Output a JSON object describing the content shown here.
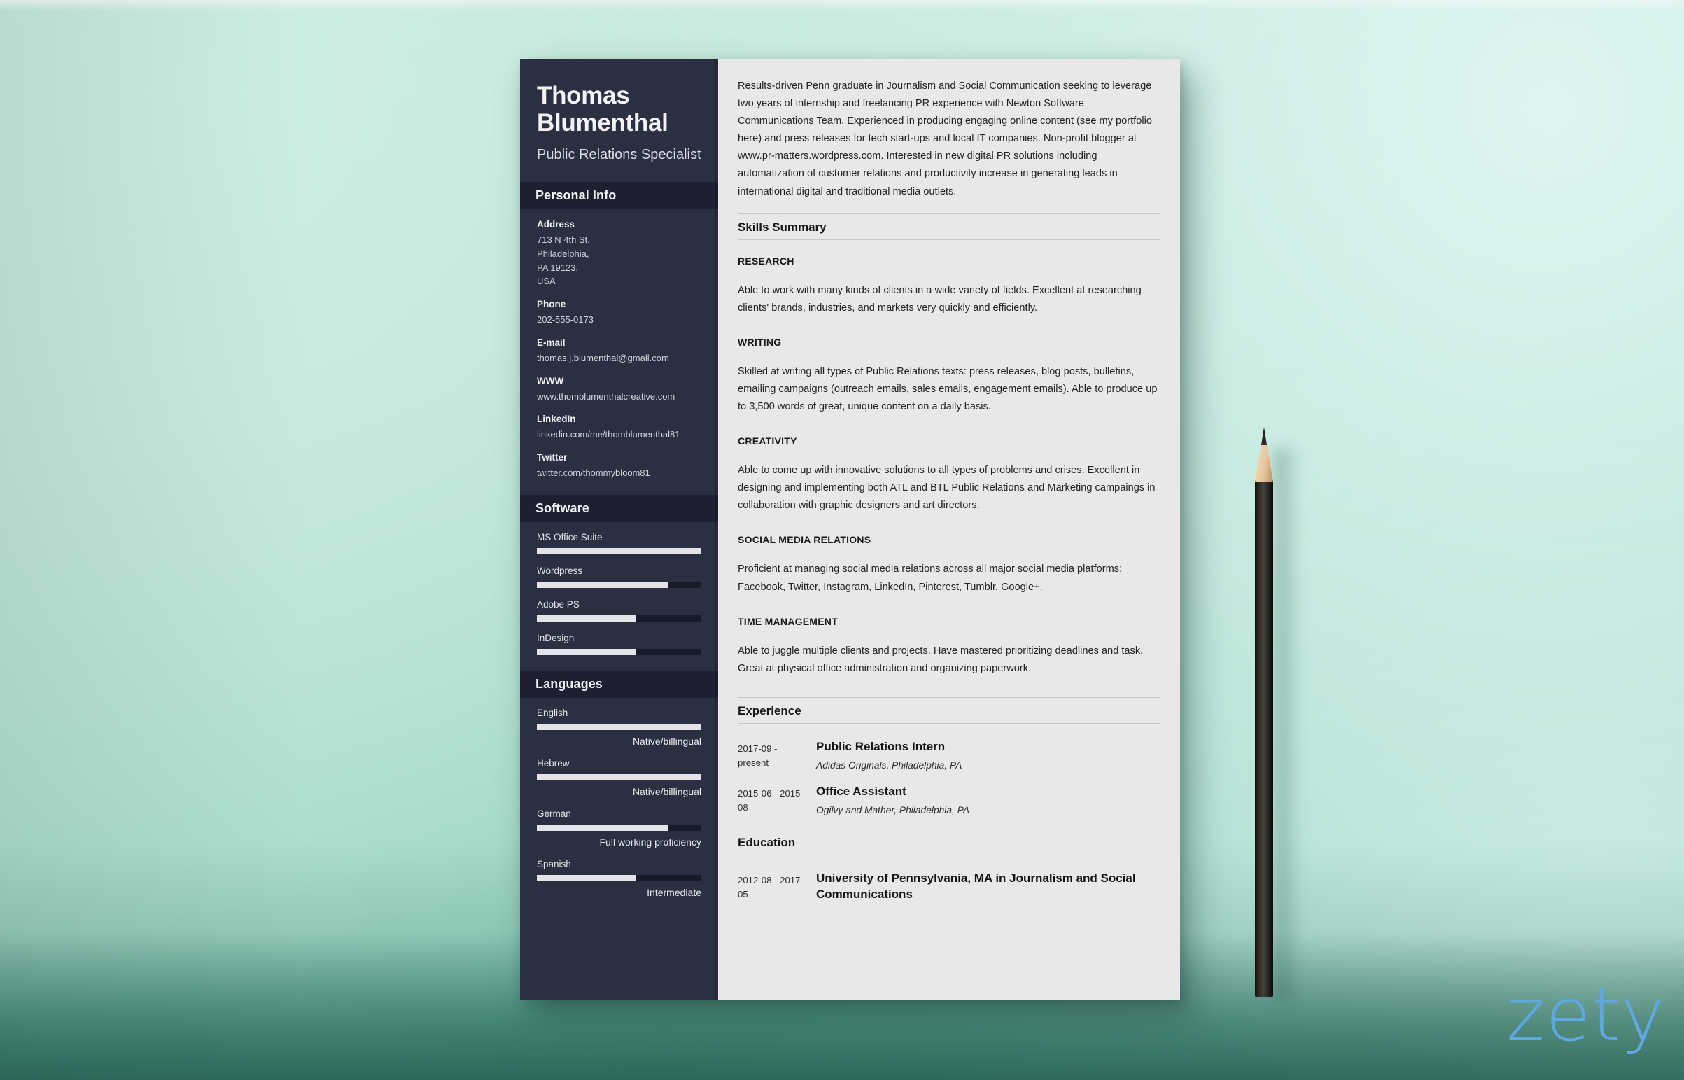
{
  "background": {
    "color_top": "#c9e9dc",
    "color_bottom": "#7ec8b6"
  },
  "watermark": {
    "text": "zety",
    "color": "#5da9e0"
  },
  "prop": {
    "pencil_label": "pencil"
  },
  "resume": {
    "sidebar": {
      "name": "Thomas Blumenthal",
      "job_title": "Public Relations Specialist",
      "accent_color": "#2a2f42",
      "section_bar_color": "#1c2030",
      "personal_info": {
        "heading": "Personal Info",
        "fields": [
          {
            "label": "Address",
            "lines": [
              "713 N 4th St,",
              "Philadelphia,",
              "PA 19123,",
              "USA"
            ]
          },
          {
            "label": "Phone",
            "lines": [
              "202-555-0173"
            ]
          },
          {
            "label": "E-mail",
            "lines": [
              "thomas.j.blumenthal@gmail.com"
            ]
          },
          {
            "label": "WWW",
            "lines": [
              "www.thomblumenthalcreative.com"
            ]
          },
          {
            "label": "LinkedIn",
            "lines": [
              "linkedin.com/me/thomblumenthal81"
            ]
          },
          {
            "label": "Twitter",
            "lines": [
              "twitter.com/thommybloom81"
            ]
          }
        ]
      },
      "software": {
        "heading": "Software",
        "items": [
          {
            "name": "MS Office Suite",
            "percent": 100
          },
          {
            "name": "Wordpress",
            "percent": 80
          },
          {
            "name": "Adobe PS",
            "percent": 60
          },
          {
            "name": "InDesign",
            "percent": 60
          }
        ]
      },
      "languages": {
        "heading": "Languages",
        "items": [
          {
            "name": "English",
            "percent": 100,
            "level": "Native/billingual"
          },
          {
            "name": "Hebrew",
            "percent": 100,
            "level": "Native/billingual"
          },
          {
            "name": "German",
            "percent": 80,
            "level": "Full working proficiency"
          },
          {
            "name": "Spanish",
            "percent": 60,
            "level": "Intermediate"
          }
        ]
      }
    },
    "main": {
      "summary": "Results-driven Penn graduate in Journalism and Social Communication seeking to leverage two years of internship and freelancing PR experience with Newton Software Communications Team. Experienced in producing engaging online content (see my portfolio here) and press releases for tech start-ups and local IT companies. Non-profit blogger at www.pr-matters.wordpress.com. Interested in new digital PR solutions including automatization of customer relations and productivity increase in generating leads in international digital and traditional media outlets.",
      "skills_summary": {
        "heading": "Skills Summary",
        "skills": [
          {
            "name": "RESEARCH",
            "text": "Able to work with many kinds of clients in a wide variety of fields. Excellent at researching clients' brands, industries, and markets very quickly and efficiently."
          },
          {
            "name": "WRITING",
            "text": "Skilled at writing all types of Public Relations texts: press releases, blog posts, bulletins, emailing campaigns (outreach emails, sales emails, engagement emails). Able to produce up to 3,500 words of great, unique content on a daily basis."
          },
          {
            "name": "CREATIVITY",
            "text": "Able to come up with innovative solutions to all types of problems and crises. Excellent in designing and implementing both ATL and BTL Public Relations and Marketing campaings in collaboration with graphic designers and art directors."
          },
          {
            "name": "SOCIAL MEDIA RELATIONS",
            "text": "Proficient at managing social media relations across all major social media platforms: Facebook, Twitter, Instagram, LinkedIn, Pinterest, Tumblr, Google+."
          },
          {
            "name": "TIME MANAGEMENT",
            "text": "Able to juggle multiple clients and projects. Have mastered prioritizing deadlines and task. Great at physical office administration and organizing paperwork."
          }
        ]
      },
      "experience": {
        "heading": "Experience",
        "entries": [
          {
            "date": "2017-09 - present",
            "role": "Public Relations Intern",
            "org": "Adidas Originals, Philadelphia, PA"
          },
          {
            "date": "2015-06 - 2015-08",
            "role": "Office Assistant",
            "org": "Ogilvy and Mather, Philadelphia, PA"
          }
        ]
      },
      "education": {
        "heading": "Education",
        "entries": [
          {
            "date": "2012-08 - 2017-05",
            "role": "University of Pennsylvania, MA in Journalism and Social Communications",
            "org": ""
          }
        ]
      }
    }
  }
}
